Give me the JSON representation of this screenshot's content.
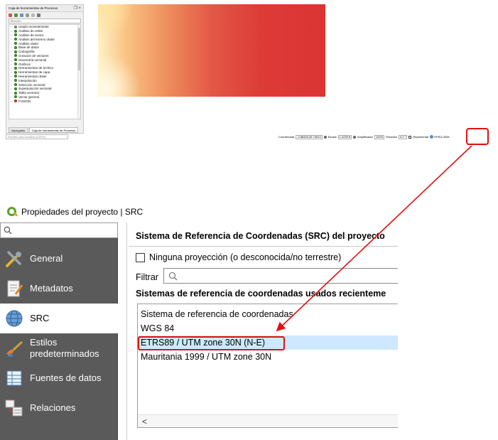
{
  "toolbox": {
    "title": "Caja de herramientas de Procesos",
    "window_controls": "❐ ×",
    "search_placeholder": "Buscar...",
    "items": [
      {
        "label": "Usado recientemente"
      },
      {
        "label": "Análisis de redes"
      },
      {
        "label": "Análisis de vector"
      },
      {
        "label": "Análisis del terreno ráster"
      },
      {
        "label": "Análisis ráster"
      },
      {
        "label": "Base de datos"
      },
      {
        "label": "Cartografía"
      },
      {
        "label": "Creación de vectores"
      },
      {
        "label": "Geometría vectorial"
      },
      {
        "label": "Gráficos"
      },
      {
        "label": "Herramientas de archivo"
      },
      {
        "label": "Herramientas de capa"
      },
      {
        "label": "Herramientas ráster"
      },
      {
        "label": "Interpolación"
      },
      {
        "label": "Selección vectorial"
      },
      {
        "label": "Superposición vectorial"
      },
      {
        "label": "Tabla vectorial"
      },
      {
        "label": "Vector general"
      },
      {
        "label": "FUSION"
      }
    ],
    "tabs": [
      "Navegador",
      "Caja de herramientas de Procesos"
    ]
  },
  "locator_placeholder": "Escribe para localizar (Ctrl+K)",
  "statusbar": {
    "coord_label": "Coordenada",
    "coord_value": "-3.88326,40.74613",
    "scale_label": "Escala",
    "scale_value": "1:4239",
    "magnifier_label": "Amplificador",
    "magnifier_value": "100%",
    "rotation_label": "Rotación",
    "rotation_value": "0,0 °",
    "render_label": "Representar",
    "epsg": "EPSG:4326"
  },
  "dialog": {
    "title": "Propiedades del proyecto | SRC",
    "sidebar": [
      {
        "label": "General",
        "icon": "tools-icon"
      },
      {
        "label": "Metadatos",
        "icon": "document-pencil-icon"
      },
      {
        "label": "SRC",
        "icon": "globe-icon"
      },
      {
        "label": "Estilos predeterminados",
        "icon": "brush-icon"
      },
      {
        "label": "Fuentes de datos",
        "icon": "table-icon"
      },
      {
        "label": "Relaciones",
        "icon": "relations-icon"
      }
    ],
    "section_title": "Sistema de Referencia de Coordenadas (SRC) del proyecto",
    "no_projection_label": "Ninguna proyección (o desconocida/no terrestre)",
    "filter_label": "Filtrar",
    "recent_title": "Sistemas de referencia de coordenadas usados recienteme",
    "crs_list": [
      {
        "name": "Sistema de referencia de coordenadas"
      },
      {
        "name": "WGS 84"
      },
      {
        "name": "ETRS89 / UTM zone 30N (N-E)"
      },
      {
        "name": "Mauritania 1999 / UTM zone 30N"
      }
    ],
    "scroll_left": "<"
  },
  "colors": {
    "highlight": "#e01010",
    "selected_row": "#cde8ff",
    "sidebar_bg": "#5a5a5a"
  }
}
